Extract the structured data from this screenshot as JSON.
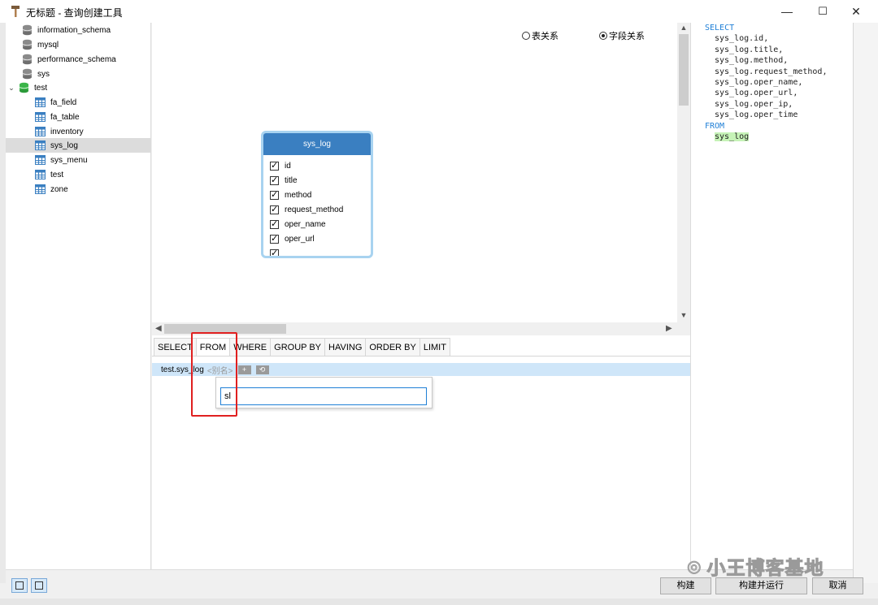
{
  "window": {
    "title": "无标题 - 查询创建工具",
    "minimize": "—",
    "maximize": "☐",
    "close": "✕"
  },
  "tree": {
    "items": [
      {
        "label": "information_schema",
        "type": "db"
      },
      {
        "label": "mysql",
        "type": "db"
      },
      {
        "label": "performance_schema",
        "type": "db"
      },
      {
        "label": "sys",
        "type": "db"
      },
      {
        "label": "test",
        "type": "db-open",
        "expander": "⌄"
      },
      {
        "label": "fa_field",
        "type": "table"
      },
      {
        "label": "fa_table",
        "type": "table"
      },
      {
        "label": "inventory",
        "type": "table"
      },
      {
        "label": "sys_log",
        "type": "table",
        "selected": true
      },
      {
        "label": "sys_menu",
        "type": "table"
      },
      {
        "label": "test",
        "type": "table"
      },
      {
        "label": "zone",
        "type": "table"
      }
    ]
  },
  "canvas": {
    "radio_table": "表关系",
    "radio_field": "字段关系",
    "selected": "radio_field",
    "table_card": {
      "name": "sys_log",
      "fields": [
        "id",
        "title",
        "method",
        "request_method",
        "oper_name",
        "oper_url"
      ]
    }
  },
  "sql": {
    "select_kw": "SELECT",
    "columns": [
      "sys_log.id,",
      "sys_log.title,",
      "sys_log.method,",
      "sys_log.request_method,",
      "sys_log.oper_name,",
      "sys_log.oper_url,",
      "sys_log.oper_ip,",
      "sys_log.oper_time"
    ],
    "from_kw": "FROM",
    "from_table": "sys_log"
  },
  "clauses": {
    "tabs": [
      "SELECT",
      "FROM",
      "WHERE",
      "GROUP BY",
      "HAVING",
      "ORDER BY",
      "LIMIT"
    ],
    "active": "FROM",
    "from_table": "test.sys_log",
    "alias_placeholder": "<别名>",
    "add_btn": "+",
    "join_btn": "⟲",
    "popup_input_value": "sl"
  },
  "buttons": {
    "build": "构建",
    "build_run": "构建并运行",
    "cancel": "取消"
  },
  "watermark": "小王博客基地",
  "colors": {
    "accent": "#3a7fc1",
    "sql_keyword": "#1f7fd6",
    "highlight_box": "#e02020",
    "from_row": "#cfe6f9"
  }
}
